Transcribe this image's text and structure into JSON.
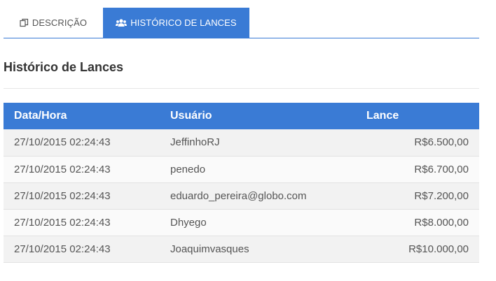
{
  "tabs": [
    {
      "label": "DESCRIÇÃO",
      "icon": "copy-icon",
      "active": false
    },
    {
      "label": "HISTÓRICO DE LANCES",
      "icon": "users-icon",
      "active": true
    }
  ],
  "section_title": "Histórico de Lances",
  "table": {
    "headers": {
      "date": "Data/Hora",
      "user": "Usuário",
      "bid": "Lance"
    },
    "rows": [
      {
        "date": "27/10/2015 02:24:43",
        "user": "JeffinhoRJ",
        "bid": "R$6.500,00"
      },
      {
        "date": "27/10/2015 02:24:43",
        "user": "penedo",
        "bid": "R$6.700,00"
      },
      {
        "date": "27/10/2015 02:24:43",
        "user": "eduardo_pereira@globo.com",
        "bid": "R$7.200,00"
      },
      {
        "date": "27/10/2015 02:24:43",
        "user": "Dhyego",
        "bid": "R$8.000,00"
      },
      {
        "date": "27/10/2015 02:24:43",
        "user": "Joaquimvasques",
        "bid": "R$10.000,00"
      }
    ]
  },
  "colors": {
    "accent": "#3a7bd5",
    "row_odd": "#f2f2f2",
    "row_even": "#fafafa"
  }
}
